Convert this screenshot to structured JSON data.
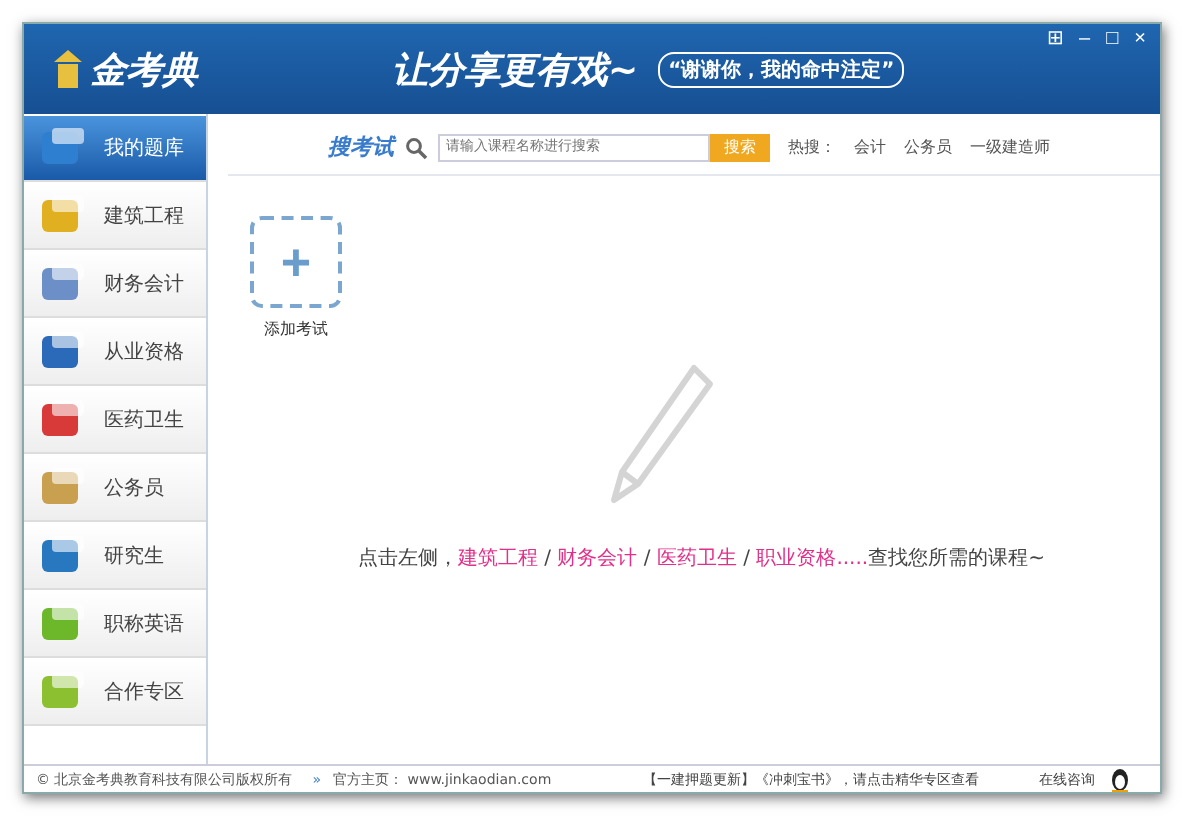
{
  "window": {
    "logo": "金考典",
    "slogan": "让分享更有戏~",
    "tagline": "“谢谢你，我的命中注定”",
    "controls": [
      "⊞",
      "–",
      "□",
      "×"
    ]
  },
  "sidebar": {
    "items": [
      {
        "label": "我的题库",
        "selected": true,
        "color": "#2f7fd0"
      },
      {
        "label": "建筑工程",
        "selected": false,
        "color": "#e0b020"
      },
      {
        "label": "财务会计",
        "selected": false,
        "color": "#6c8fc8"
      },
      {
        "label": "从业资格",
        "selected": false,
        "color": "#2a6ab8"
      },
      {
        "label": "医药卫生",
        "selected": false,
        "color": "#d83a3a"
      },
      {
        "label": "公务员",
        "selected": false,
        "color": "#c8a050"
      },
      {
        "label": "研究生",
        "selected": false,
        "color": "#2878c0"
      },
      {
        "label": "职称英语",
        "selected": false,
        "color": "#6cb82a"
      },
      {
        "label": "合作专区",
        "selected": false,
        "color": "#8cc030"
      }
    ]
  },
  "search": {
    "title": "搜考试",
    "placeholder": "请输入课程名称进行搜索",
    "button": "搜索",
    "hot_label": "热搜：",
    "hot": [
      "会计",
      "公务员",
      "一级建造师"
    ]
  },
  "add_exam": {
    "icon": "+",
    "label": "添加考试"
  },
  "hint": [
    {
      "kind": "plain",
      "text": "点击左侧，"
    },
    {
      "kind": "link",
      "text": "建筑工程"
    },
    {
      "kind": "plain",
      "text": " / "
    },
    {
      "kind": "link",
      "text": "财务会计"
    },
    {
      "kind": "plain",
      "text": " / "
    },
    {
      "kind": "link",
      "text": "医药卫生"
    },
    {
      "kind": "plain",
      "text": " / "
    },
    {
      "kind": "link",
      "text": "职业资格....."
    },
    {
      "kind": "plain",
      "text": "查找您所需的课程~"
    }
  ],
  "status_bar": {
    "copyright": "© 北京金考典教育科技有限公司版权所有",
    "arrow": "»",
    "homepage": "官方主页： www.jinkaodian.com",
    "notice": "【一建押题更新】《冲刺宝书》，请点击精华专区查看",
    "consult": "在线咨询"
  }
}
